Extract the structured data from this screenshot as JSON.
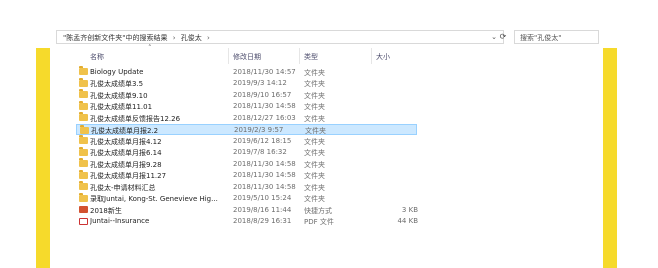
{
  "colors": {
    "accent_stripe": "#f6da2b",
    "selection": "#cce8ff"
  },
  "address_bar": {
    "path": [
      "\"陈孟齐创新文件夹\"中的搜索结果",
      "孔俊太"
    ],
    "chevron_icon": "chevron-right-icon"
  },
  "search": {
    "placeholder": "搜索\"孔俊太\""
  },
  "columns": {
    "name": "名称",
    "date": "修改日期",
    "type": "类型",
    "size": "大小"
  },
  "files": [
    {
      "name": "Biology Update",
      "date": "2018/11/30 14:57",
      "type": "文件夹",
      "size": "",
      "icon": "folder-icon"
    },
    {
      "name": "孔俊太成绩单3.5",
      "date": "2019/9/3 14:12",
      "type": "文件夹",
      "size": "",
      "icon": "folder-icon"
    },
    {
      "name": "孔俊太成绩单9.10",
      "date": "2018/9/10 16:57",
      "type": "文件夹",
      "size": "",
      "icon": "folder-icon"
    },
    {
      "name": "孔俊太成绩单11.01",
      "date": "2018/11/30 14:58",
      "type": "文件夹",
      "size": "",
      "icon": "folder-icon"
    },
    {
      "name": "孔俊太成绩单反馈报告12.26",
      "date": "2018/12/27 16:03",
      "type": "文件夹",
      "size": "",
      "icon": "folder-icon"
    },
    {
      "name": "孔俊太成绩单月报2.2",
      "date": "2019/2/3 9:57",
      "type": "文件夹",
      "size": "",
      "icon": "folder-icon",
      "selected": true
    },
    {
      "name": "孔俊太成绩单月报4.12",
      "date": "2019/6/12 18:15",
      "type": "文件夹",
      "size": "",
      "icon": "folder-icon"
    },
    {
      "name": "孔俊太成绩单月报6.14",
      "date": "2019/7/8 16:32",
      "type": "文件夹",
      "size": "",
      "icon": "folder-icon"
    },
    {
      "name": "孔俊太成绩单月报9.28",
      "date": "2018/11/30 14:58",
      "type": "文件夹",
      "size": "",
      "icon": "folder-icon"
    },
    {
      "name": "孔俊太成绩单月报11.27",
      "date": "2018/11/30 14:58",
      "type": "文件夹",
      "size": "",
      "icon": "folder-icon"
    },
    {
      "name": "孔俊太-申请材料汇总",
      "date": "2018/11/30 14:58",
      "type": "文件夹",
      "size": "",
      "icon": "folder-icon"
    },
    {
      "name": "录取Juntai, Kong-St. Genevieve Hig...",
      "date": "2019/5/10 15:24",
      "type": "文件夹",
      "size": "",
      "icon": "folder-icon"
    },
    {
      "name": "2018新生",
      "date": "2019/8/16 11:44",
      "type": "快捷方式",
      "size": "3 KB",
      "icon": "ppt-icon"
    },
    {
      "name": "Juntai--Insurance",
      "date": "2018/8/29 16:31",
      "type": "PDF 文件",
      "size": "44 KB",
      "icon": "pdf-icon"
    }
  ]
}
